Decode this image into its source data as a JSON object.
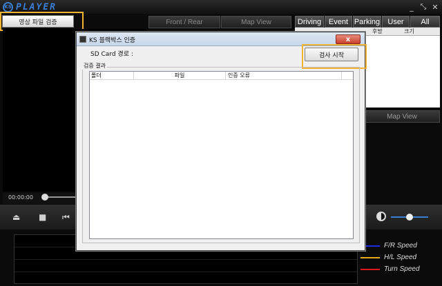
{
  "app": {
    "logo_badge": "KS",
    "logo_text": "PLAYER"
  },
  "window_buttons": {
    "minimize": "_",
    "restore": "⤡",
    "close": "✕"
  },
  "toolbar": {
    "verify_label": "영상 파일 검증"
  },
  "view_tabs": {
    "front_rear": "Front / Rear",
    "map_view": "Map View"
  },
  "filter_tabs": [
    "Driving",
    "Event",
    "Parking",
    "User",
    "All"
  ],
  "file_table": {
    "headers": [
      "후방",
      "크기"
    ]
  },
  "map_view_bottom": "Map View",
  "playback": {
    "time": "00:00:00",
    "progress": 0
  },
  "controls": {
    "eject": "⏏",
    "stop": "■",
    "prev": "⏮"
  },
  "brightness": {
    "level": 0.45
  },
  "legend": [
    {
      "label": "F/R Speed",
      "color": "#1a2ee8"
    },
    {
      "label": "H/L Speed",
      "color": "#e8a91a"
    },
    {
      "label": "Turn Speed",
      "color": "#e01a1a"
    }
  ],
  "dialog": {
    "title": "KS 블랙박스 인증",
    "close_label": "x",
    "sd_card_label": "SD Card 경로 :",
    "start_button": "검사 시작",
    "group_label": "검증 결과",
    "columns": [
      "폴더",
      "파일",
      "인증 오류"
    ]
  },
  "colors": {
    "accent": "#3b7fd4",
    "highlight": "#f2b330"
  }
}
